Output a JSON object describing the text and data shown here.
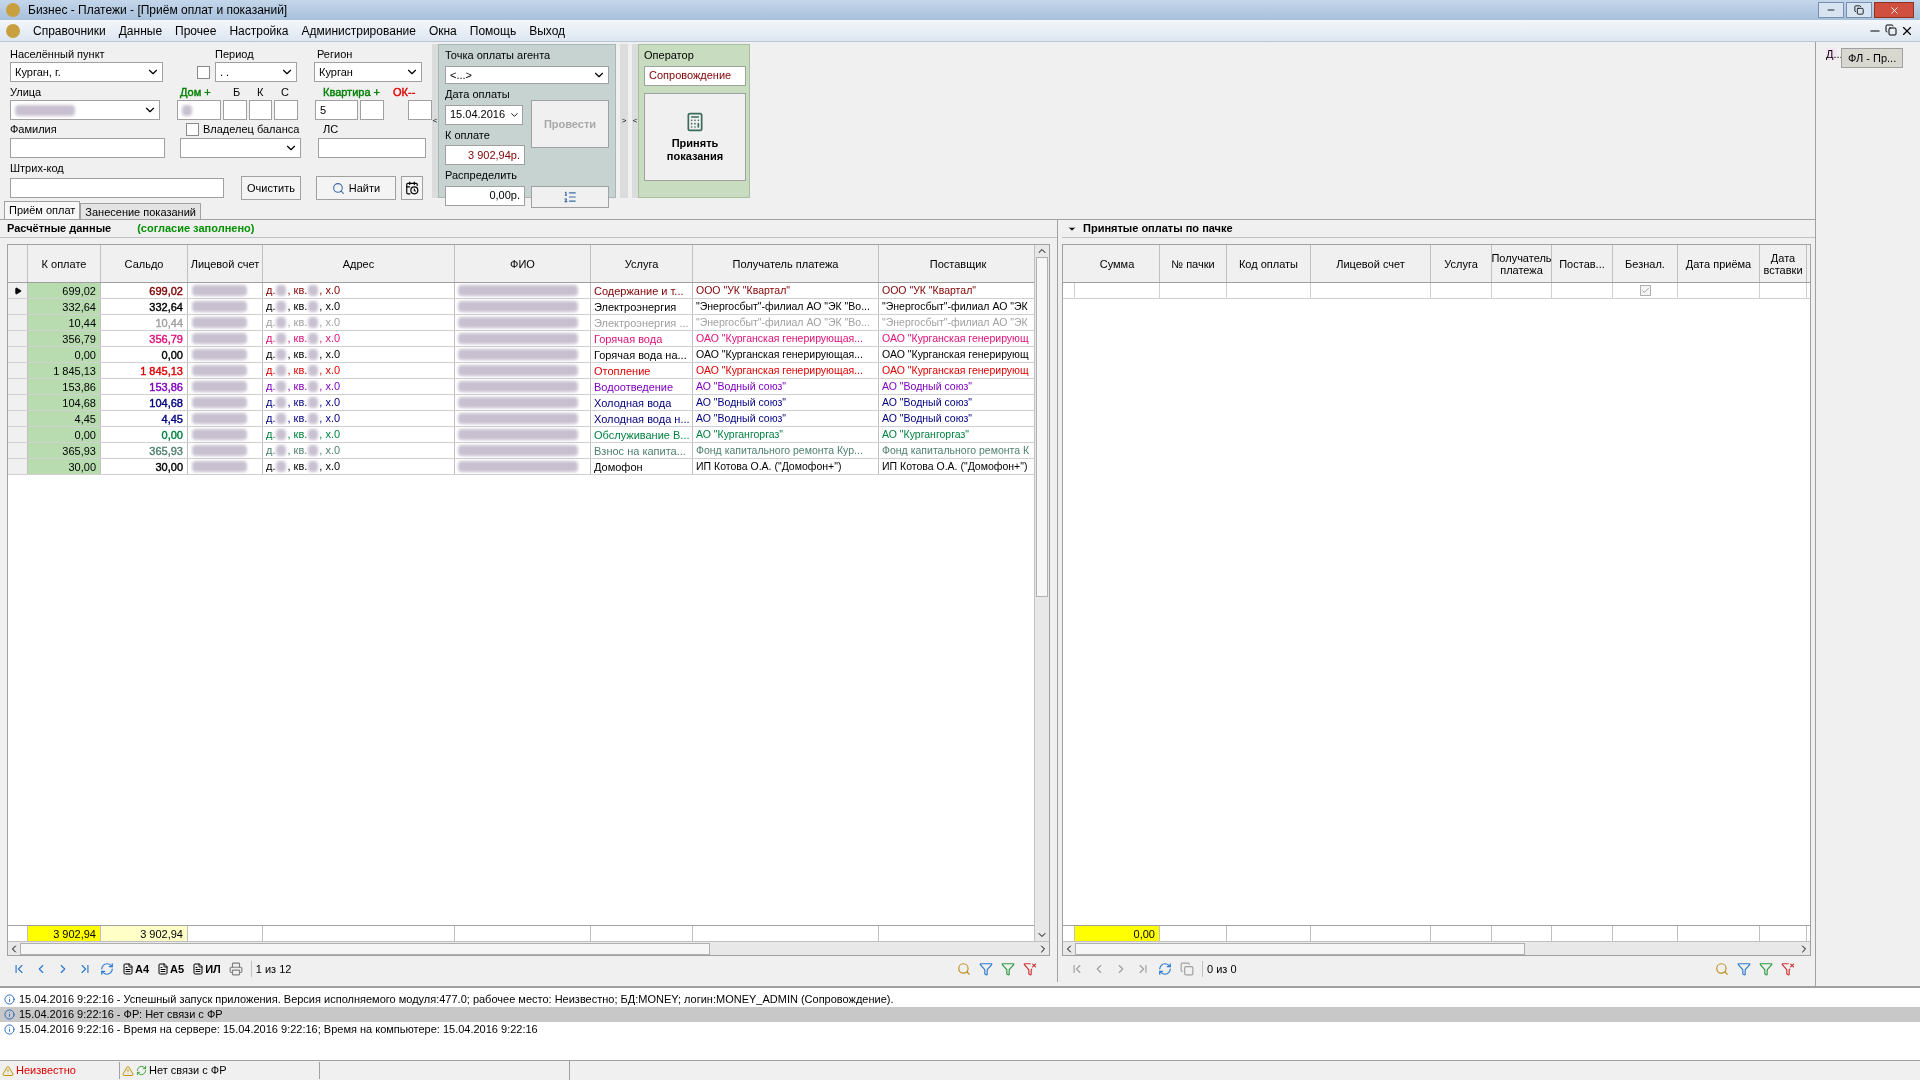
{
  "window": {
    "title": "Бизнес - Платежи - [Приём оплат и показаний]"
  },
  "menu": [
    "Справочники",
    "Данные",
    "Прочее",
    "Настройка",
    "Администрирование",
    "Окна",
    "Помощь",
    "Выход"
  ],
  "form": {
    "settlement": {
      "label": "Населённый пункт",
      "value": "Курган, г."
    },
    "period": {
      "label": "Период",
      "value": " . .",
      "checked": false
    },
    "region": {
      "label": "Регион",
      "value": "Курган"
    },
    "street": {
      "label": "Улица"
    },
    "house": {
      "label": "Дом +",
      "color": "#008000",
      "parts": [
        "Б",
        "К",
        "С"
      ]
    },
    "flat": {
      "label": "Квартира +",
      "color": "#008000",
      "value": "5"
    },
    "ok": {
      "label": "ОК--",
      "color": "#e00000"
    },
    "surname": {
      "label": "Фамилия"
    },
    "owner": {
      "label": "Владелец баланса",
      "checked": false
    },
    "account": {
      "label": "ЛС"
    },
    "barcode": {
      "label": "Штрих-код"
    },
    "clear_button": "Очистить",
    "find_button": "Найти"
  },
  "agent": {
    "point_label": "Точка оплаты агента",
    "point_value": "<...>",
    "date_label": "Дата оплаты",
    "date_value": "15.04.2016",
    "due_label": "К оплате",
    "due_value": "3 902,94р.",
    "distribute_label": "Распределить",
    "distribute_value": "0,00р.",
    "post_button": {
      "label": "Провести",
      "disabled": true
    },
    "left_arrow": "<",
    "right_arrow": ">",
    "left_arrow_2": "<"
  },
  "operator": {
    "label": "Оператор",
    "value": "Сопровождение",
    "accept_button": "Принять показания"
  },
  "side_dock": {
    "tab": "Д...",
    "button": "ФЛ - Пр..."
  },
  "tabs": [
    {
      "label": "Приём оплат",
      "selected": true
    },
    {
      "label": "Занесение показаний",
      "selected": false
    }
  ],
  "left_panel": {
    "title": "Расчётные данные",
    "note": "(согласие заполнено)",
    "columns": [
      "К оплате",
      "Сальдо",
      "Лицевой счет",
      "Адрес",
      "ФИО",
      "Услуга",
      "Получатель платежа",
      "Поставщик"
    ],
    "rows": [
      {
        "selected": true,
        "color": "#800000",
        "due": "699,02",
        "saldo": "699,02",
        "address": [
          "д.",
          ", кв.",
          ", х.0"
        ],
        "service": "Содержание и т...",
        "recipient": "ООО \"УК \"Квартал\"",
        "supplier": "ООО \"УК \"Квартал\""
      },
      {
        "selected": false,
        "color": "#000000",
        "due": "332,64",
        "saldo": "332,64",
        "address": [
          "д.",
          ", кв.",
          ", х.0"
        ],
        "service": "Электроэнергия",
        "recipient": "\"Энергосбыт\"-филиал АО \"ЭК \"Во...",
        "supplier": "\"Энергосбыт\"-филиал АО \"ЭК"
      },
      {
        "selected": false,
        "color": "#a0a0a0",
        "due": "10,44",
        "saldo": "10,44",
        "address": [
          "д.",
          ", кв.",
          ", х.0"
        ],
        "service": "Электроэнергия ...",
        "recipient": "\"Энергосбыт\"-филиал АО \"ЭК \"Во...",
        "supplier": "\"Энергосбыт\"-филиал АО \"ЭК"
      },
      {
        "selected": false,
        "color": "#e0107a",
        "due": "356,79",
        "saldo": "356,79",
        "address": [
          "д.",
          ", кв.",
          ", х.0"
        ],
        "service": "Горячая вода",
        "recipient": "ОАО \"Курганская генерирующая...",
        "supplier": "ОАО \"Курганская генерирующ"
      },
      {
        "selected": false,
        "color": "#000000",
        "due": "0,00",
        "saldo": "0,00",
        "address": [
          "д.",
          ", кв.",
          ", х.0"
        ],
        "service": "Горячая вода на...",
        "recipient": "ОАО \"Курганская генерирующая...",
        "supplier": "ОАО \"Курганская генерирующ"
      },
      {
        "selected": false,
        "color": "#e00000",
        "due": "1 845,13",
        "saldo": "1 845,13",
        "address": [
          "д.",
          ", кв.",
          ", х.0"
        ],
        "service": "Отопление",
        "recipient": "ОАО \"Курганская генерирующая...",
        "supplier": "ОАО \"Курганская генерирующ"
      },
      {
        "selected": false,
        "color": "#8000c0",
        "due": "153,86",
        "saldo": "153,86",
        "address": [
          "д.",
          ", кв.",
          ", х.0"
        ],
        "service": "Водоотведение",
        "recipient": "АО \"Водный союз\"",
        "supplier": "АО \"Водный союз\""
      },
      {
        "selected": false,
        "color": "#000080",
        "due": "104,68",
        "saldo": "104,68",
        "address": [
          "д.",
          ", кв.",
          ", х.0"
        ],
        "service": "Холодная вода",
        "recipient": "АО \"Водный союз\"",
        "supplier": "АО \"Водный союз\""
      },
      {
        "selected": false,
        "color": "#000080",
        "due": "4,45",
        "saldo": "4,45",
        "address": [
          "д.",
          ", кв.",
          ", х.0"
        ],
        "service": "Холодная вода н...",
        "recipient": "АО \"Водный союз\"",
        "supplier": "АО \"Водный союз\""
      },
      {
        "selected": false,
        "color": "#008040",
        "due": "0,00",
        "saldo": "0,00",
        "address": [
          "д.",
          ", кв.",
          ", х.0"
        ],
        "service": "Обслуживание В...",
        "recipient": "АО \"Кургангоргаз\"",
        "supplier": "АО \"Кургангоргаз\""
      },
      {
        "selected": false,
        "color": "#508070",
        "due": "365,93",
        "saldo": "365,93",
        "address": [
          "д.",
          ", кв.",
          ", х.0"
        ],
        "service": "Взнос на капита...",
        "recipient": "Фонд капитального ремонта Кур...",
        "supplier": "Фонд капитального ремонта К"
      },
      {
        "selected": false,
        "color": "#000000",
        "due": "30,00",
        "saldo": "30,00",
        "address": [
          "д.",
          ", кв.",
          ", х.0"
        ],
        "service": "Домофон",
        "recipient": "ИП Котова О.А. (\"Домофон+\")",
        "supplier": "ИП Котова О.А. (\"Домофон+\")"
      }
    ],
    "totals": [
      "3 902,94",
      "3 902,94"
    ],
    "nav": {
      "labels": [
        "A4",
        "A5",
        "ИЛ"
      ],
      "counter": "1 из 12"
    }
  },
  "right_panel": {
    "title": "Принятые оплаты по пачке",
    "columns": [
      "Сумма",
      "№ пачки",
      "Код оплаты",
      "Лицевой счет",
      "Услуга",
      "Получатель платежа",
      "Постав...",
      "Безнал.",
      "Дата приёма",
      "Дата вставки"
    ],
    "rows": [
      {
        "cashless": true
      }
    ],
    "total": "0,00",
    "nav": {
      "counter": "0 из 0"
    }
  },
  "log": [
    {
      "text": "15.04.2016 9:22:16 -  Успешный запуск приложения. Версия исполняемого модуля:477.0; рабочее место: Неизвестно; БД:MONEY; логин:MONEY_ADMIN (Сопровождение).",
      "selected": false
    },
    {
      "text": "15.04.2016 9:22:16 -  ФР: Нет связи с ФР",
      "selected": true
    },
    {
      "text": "15.04.2016 9:22:16 -  Время на сервере: 15.04.2016 9:22:16; Время на компьютере: 15.04.2016 9:22:16",
      "selected": false
    }
  ],
  "status_bar": {
    "workplace": "Неизвестно",
    "fr": "Нет связи с ФР"
  }
}
